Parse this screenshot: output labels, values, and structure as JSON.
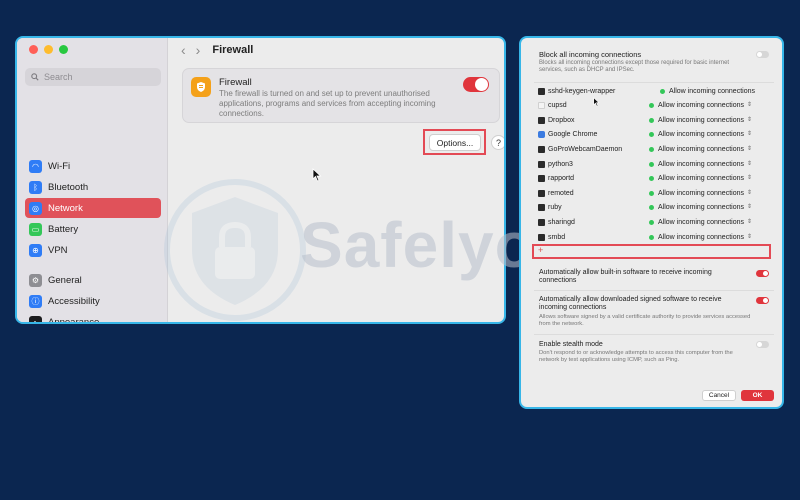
{
  "left_window": {
    "search_placeholder": "Search",
    "sidebar": {
      "items": [
        {
          "label": "Wi-Fi",
          "icon": "wifi-icon",
          "color": "#2f7cf6",
          "active": false
        },
        {
          "label": "Bluetooth",
          "icon": "bluetooth-icon",
          "color": "#2f7cf6",
          "active": false
        },
        {
          "label": "Network",
          "icon": "globe-icon",
          "color": "#2f7cf6",
          "active": true
        },
        {
          "label": "Battery",
          "icon": "battery-icon",
          "color": "#34c759",
          "active": false
        },
        {
          "label": "VPN",
          "icon": "vpn-icon",
          "color": "#2f7cf6",
          "active": false
        },
        {
          "label": "General",
          "icon": "gear-icon",
          "color": "#8e8e93",
          "active": false
        },
        {
          "label": "Accessibility",
          "icon": "accessibility-icon",
          "color": "#2f7cf6",
          "active": false
        },
        {
          "label": "Appearance",
          "icon": "appearance-icon",
          "color": "#1c1c1e",
          "active": false
        }
      ]
    },
    "page_title": "Firewall",
    "firewall": {
      "title": "Firewall",
      "description": "The firewall is turned on and set up to prevent unauthorised applications, programs and services from accepting incoming connections.",
      "enabled": true
    },
    "options_label": "Options...",
    "help_label": "?"
  },
  "watermark": {
    "text": "Safelyo"
  },
  "right_window": {
    "block_all": {
      "title": "Block all incoming connections",
      "description": "Blocks all incoming connections except those required for basic internet services, such as DHCP and IPSec.",
      "enabled": false
    },
    "apps": [
      {
        "name": "sshd-keygen-wrapper",
        "status": "Allow incoming connections",
        "icon": "dark",
        "stepper": false
      },
      {
        "name": "cupsd",
        "status": "Allow incoming connections",
        "icon": "light",
        "stepper": true
      },
      {
        "name": "Dropbox",
        "status": "Allow incoming connections",
        "icon": "dark",
        "stepper": true
      },
      {
        "name": "Google Chrome",
        "status": "Allow incoming connections",
        "icon": "chrome",
        "stepper": true
      },
      {
        "name": "GoProWebcamDaemon",
        "status": "Allow incoming connections",
        "icon": "dark",
        "stepper": true
      },
      {
        "name": "python3",
        "status": "Allow incoming connections",
        "icon": "dark",
        "stepper": true
      },
      {
        "name": "rapportd",
        "status": "Allow incoming connections",
        "icon": "dark",
        "stepper": true
      },
      {
        "name": "remoted",
        "status": "Allow incoming connections",
        "icon": "dark",
        "stepper": true
      },
      {
        "name": "ruby",
        "status": "Allow incoming connections",
        "icon": "dark",
        "stepper": true
      },
      {
        "name": "sharingd",
        "status": "Allow incoming connections",
        "icon": "dark",
        "stepper": true
      },
      {
        "name": "smbd",
        "status": "Allow incoming connections",
        "icon": "dark",
        "stepper": true
      }
    ],
    "add_label": "+",
    "auto_builtin": {
      "title": "Automatically allow built-in software to receive incoming connections",
      "enabled": true
    },
    "auto_signed": {
      "title": "Automatically allow downloaded signed software to receive incoming connections",
      "description": "Allows software signed by a valid certificate authority to provide services accessed from the network.",
      "enabled": true
    },
    "stealth": {
      "title": "Enable stealth mode",
      "description": "Don't respond to or acknowledge attempts to access this computer from the network by test applications using ICMP, such as Ping.",
      "enabled": false
    },
    "cancel_label": "Cancel",
    "ok_label": "OK"
  },
  "colors": {
    "background": "#0b2650",
    "accent_red": "#e0353c",
    "highlight_border": "#e34a55",
    "window_border": "#37b6e8",
    "status_green": "#34c759"
  }
}
